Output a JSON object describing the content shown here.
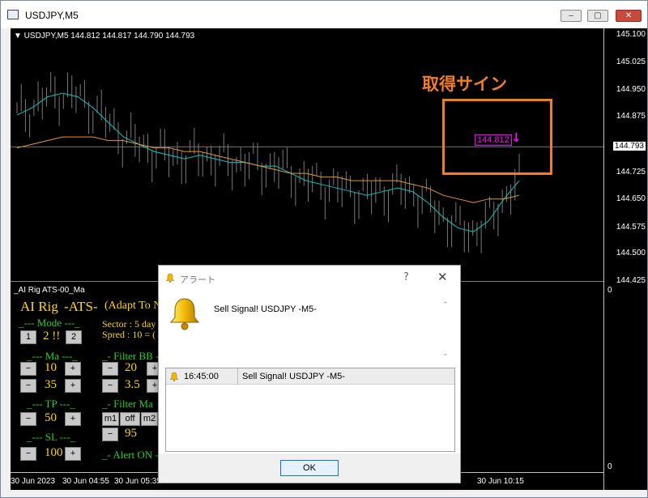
{
  "window": {
    "title": "USDJPY,M5",
    "min": "‒",
    "max": "▢",
    "close": "✕"
  },
  "chart": {
    "symbol_line": "▼ USDJPY,M5  144.812 144.817 144.790 144.793",
    "annotation": "取得サイン",
    "sell_price_label": "144.812",
    "sell_arrow": "↓",
    "indicator_label": "_AI Rig ATS-00_Ma"
  },
  "chart_data": {
    "type": "line",
    "price_ticks": [
      "145.100",
      "145.025",
      "144.950",
      "144.875",
      "144.793",
      "144.725",
      "144.650",
      "144.575",
      "144.500",
      "144.425"
    ],
    "current_price": "144.793",
    "indicator_ticks": [
      "0",
      "0"
    ],
    "time_ticks": [
      "30 Jun 2023",
      "30 Jun 04:55",
      "30 Jun 05:35",
      "30 Jun 10:15"
    ],
    "series": [
      {
        "color": "#00c8c8",
        "values": [
          144.88,
          144.9,
          144.93,
          144.94,
          144.93,
          144.9,
          144.86,
          144.82,
          144.8,
          144.78,
          144.77,
          144.76,
          144.77,
          144.76,
          144.75,
          144.75,
          144.74,
          144.74,
          144.72,
          144.7,
          144.69,
          144.68,
          144.67,
          144.66,
          144.67,
          144.68,
          144.67,
          144.64,
          144.6,
          144.57,
          144.56,
          144.59,
          144.65,
          144.7
        ]
      },
      {
        "color": "#e89530",
        "values": [
          144.79,
          144.8,
          144.81,
          144.82,
          144.82,
          144.82,
          144.81,
          144.81,
          144.8,
          144.79,
          144.79,
          144.78,
          144.78,
          144.77,
          144.76,
          144.75,
          144.74,
          144.73,
          144.72,
          144.72,
          144.71,
          144.71,
          144.7,
          144.7,
          144.7,
          144.7,
          144.69,
          144.68,
          144.66,
          144.65,
          144.64,
          144.65,
          144.65,
          144.66
        ]
      }
    ]
  },
  "panel": {
    "title1": "AI Rig",
    "title2": "-ATS-",
    "title3": "(Adapt To N",
    "mode_label": "_--- Mode ---_",
    "mode_b1": "1",
    "mode_val": "2 !!",
    "mode_b2": "2",
    "sector": "Sector : 5 day",
    "spred": "Spred : 10 = (",
    "ma_label": "_--- Ma ---_",
    "ma_v1": "10",
    "ma_v2": "35",
    "fbb_label": "_- Filter BB -",
    "fbb_v1": "20",
    "fbb_v2": "3.5",
    "tp_label": "_--- TP ---_",
    "tp_v": "50",
    "fma_label": "_- Filter Ma",
    "fma_b1": "m1",
    "fma_b2": "off",
    "fma_b3": "m2",
    "fma_v": "95",
    "sl_label": "_--- SL ---_",
    "sl_v": "100",
    "alert_label": "_- Alert ON -",
    "minus": "−",
    "plus": "+"
  },
  "dialog": {
    "title": "アラート",
    "help": "?",
    "close": "✕",
    "message": "Sell Signal! USDJPY -M5-",
    "row_time": "16:45:00",
    "row_msg": "Sell Signal! USDJPY -M5-",
    "ok": "OK"
  }
}
